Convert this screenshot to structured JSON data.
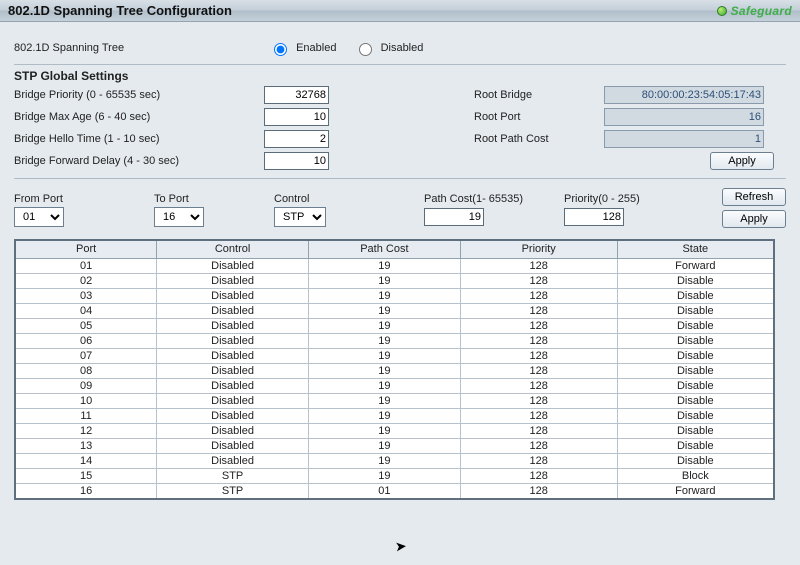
{
  "header": {
    "title": "802.1D Spanning Tree Configuration",
    "safeguard": "Safeguard"
  },
  "stp_mode": {
    "label": "802.1D Spanning Tree",
    "enabled_label": "Enabled",
    "disabled_label": "Disabled",
    "selected": "Enabled"
  },
  "global": {
    "section_title": "STP Global Settings",
    "bridge_priority_label": "Bridge Priority (0 - 65535 sec)",
    "bridge_priority_value": "32768",
    "bridge_max_age_label": "Bridge Max Age (6 - 40 sec)",
    "bridge_max_age_value": "10",
    "bridge_hello_label": "Bridge Hello Time (1 - 10 sec)",
    "bridge_hello_value": "2",
    "bridge_fwd_label": "Bridge Forward Delay (4 - 30 sec)",
    "bridge_fwd_value": "10",
    "root_bridge_label": "Root Bridge",
    "root_bridge_value": "80:00:00:23:54:05:17:43",
    "root_port_label": "Root Port",
    "root_port_value": "16",
    "root_path_cost_label": "Root Path Cost",
    "root_path_cost_value": "1",
    "apply_label": "Apply"
  },
  "portctl": {
    "from_port_label": "From Port",
    "from_port_value": "01",
    "to_port_label": "To Port",
    "to_port_value": "16",
    "control_label": "Control",
    "control_value": "STP",
    "path_cost_label": "Path Cost(1- 65535)",
    "path_cost_value": "19",
    "priority_label": "Priority(0 - 255)",
    "priority_value": "128",
    "refresh_label": "Refresh",
    "apply_label": "Apply"
  },
  "table": {
    "headers": [
      "Port",
      "Control",
      "Path Cost",
      "Priority",
      "State"
    ],
    "rows": [
      {
        "port": "01",
        "control": "Disabled",
        "cost": "19",
        "prio": "128",
        "state": "Forward"
      },
      {
        "port": "02",
        "control": "Disabled",
        "cost": "19",
        "prio": "128",
        "state": "Disable"
      },
      {
        "port": "03",
        "control": "Disabled",
        "cost": "19",
        "prio": "128",
        "state": "Disable"
      },
      {
        "port": "04",
        "control": "Disabled",
        "cost": "19",
        "prio": "128",
        "state": "Disable"
      },
      {
        "port": "05",
        "control": "Disabled",
        "cost": "19",
        "prio": "128",
        "state": "Disable"
      },
      {
        "port": "06",
        "control": "Disabled",
        "cost": "19",
        "prio": "128",
        "state": "Disable"
      },
      {
        "port": "07",
        "control": "Disabled",
        "cost": "19",
        "prio": "128",
        "state": "Disable"
      },
      {
        "port": "08",
        "control": "Disabled",
        "cost": "19",
        "prio": "128",
        "state": "Disable"
      },
      {
        "port": "09",
        "control": "Disabled",
        "cost": "19",
        "prio": "128",
        "state": "Disable"
      },
      {
        "port": "10",
        "control": "Disabled",
        "cost": "19",
        "prio": "128",
        "state": "Disable"
      },
      {
        "port": "11",
        "control": "Disabled",
        "cost": "19",
        "prio": "128",
        "state": "Disable"
      },
      {
        "port": "12",
        "control": "Disabled",
        "cost": "19",
        "prio": "128",
        "state": "Disable"
      },
      {
        "port": "13",
        "control": "Disabled",
        "cost": "19",
        "prio": "128",
        "state": "Disable"
      },
      {
        "port": "14",
        "control": "Disabled",
        "cost": "19",
        "prio": "128",
        "state": "Disable"
      },
      {
        "port": "15",
        "control": "STP",
        "cost": "19",
        "prio": "128",
        "state": "Block"
      },
      {
        "port": "16",
        "control": "STP",
        "cost": "01",
        "prio": "128",
        "state": "Forward"
      }
    ]
  }
}
